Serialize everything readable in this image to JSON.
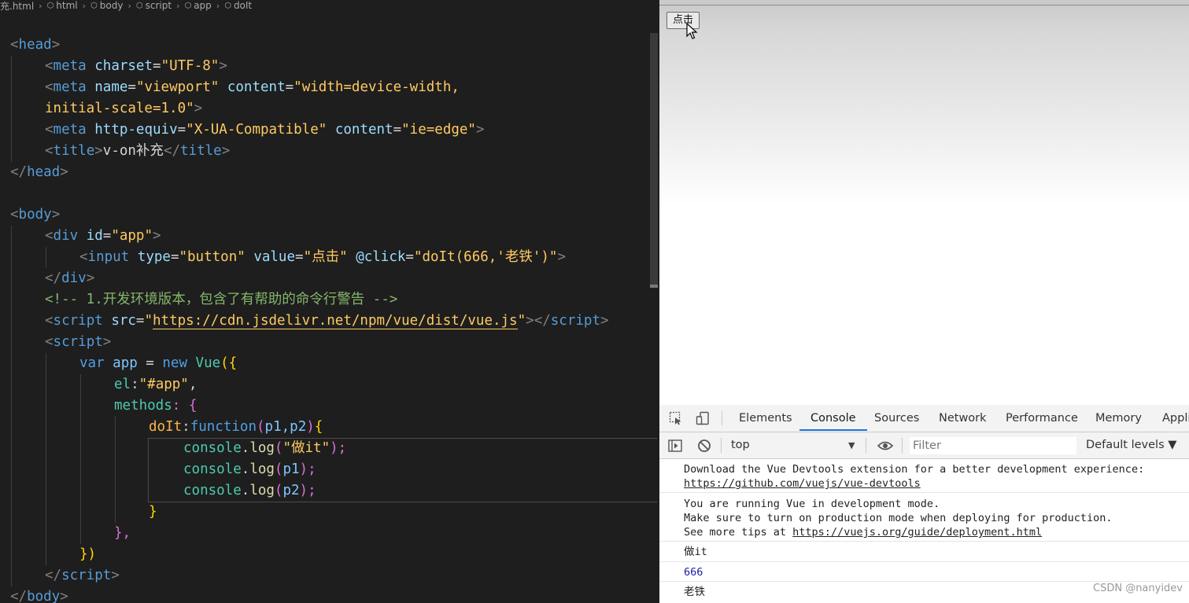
{
  "breadcrumb": [
    "充.html",
    "html",
    "body",
    "script",
    "app",
    "doIt"
  ],
  "code": {
    "head_open": "head",
    "meta1": {
      "tag": "meta",
      "attr": "charset",
      "val": "\"UTF-8\""
    },
    "meta2": {
      "tag": "meta",
      "attr1": "name",
      "val1": "\"viewport\"",
      "attr2": "content",
      "val2a": "\"width=device-width,",
      "val2b": "initial-scale=1.0\""
    },
    "meta3": {
      "tag": "meta",
      "attr1": "http-equiv",
      "val1": "\"X-UA-Compatible\"",
      "attr2": "content",
      "val2": "\"ie=edge\""
    },
    "title": {
      "tag": "title",
      "text": "v-on补充"
    },
    "head_close": "head",
    "body_open": "body",
    "div_open": {
      "tag": "div",
      "attr": "id",
      "val": "\"app\""
    },
    "input": {
      "tag": "input",
      "attr1": "type",
      "val1": "\"button\"",
      "attr2": "value",
      "val2": "\"点击\"",
      "attr3": "@click",
      "val3": "\"doIt(666,'老铁')\""
    },
    "div_close": "div",
    "comment": "<!-- 1.开发环境版本，包含了有帮助的命令行警告 -->",
    "script_src": {
      "tag": "script",
      "attr": "src",
      "q1": "\"",
      "url": "https://cdn.jsdelivr.net/npm/vue/dist/vue.js",
      "q2": "\"",
      "close": "script"
    },
    "script_open": "script",
    "var_line": {
      "kw": "var",
      "name": "app",
      "eq": " = ",
      "new": "new",
      "cls": "Vue",
      "open": "({"
    },
    "el_line": {
      "key": "el",
      "colon": ":",
      "val": "\"#app\"",
      "comma": ","
    },
    "methods_line": {
      "key": "methods",
      "rest": ": {"
    },
    "doit_line": {
      "name": "doIt",
      "colon": ":",
      "fn": "function",
      "p_open": "(",
      "params": "p1,p2",
      "p_close": ")",
      "brace": "{"
    },
    "log1": {
      "obj": "console",
      "dot": ".",
      "fn": "log",
      "open": "(",
      "arg": "\"做it\"",
      "close": ");"
    },
    "log2": {
      "obj": "console",
      "dot": ".",
      "fn": "log",
      "open": "(",
      "arg": "p1",
      "close": ");"
    },
    "log3": {
      "obj": "console",
      "dot": ".",
      "fn": "log",
      "open": "(",
      "arg": "p2",
      "close": ");"
    },
    "brace_close": "}",
    "methods_close": "},",
    "vue_close": "})",
    "script_close": "script",
    "body_close": "body"
  },
  "browser": {
    "button_label": "点击"
  },
  "devtools": {
    "tabs": [
      "Elements",
      "Console",
      "Sources",
      "Network",
      "Performance",
      "Memory",
      "Appli"
    ],
    "active_tab": "Console",
    "context": "top",
    "filter_placeholder": "Filter",
    "levels": "Default levels ▼",
    "messages": {
      "m1_l1": "Download the Vue Devtools extension for a better development experience:",
      "m1_link": "https://github.com/vuejs/vue-devtools",
      "m2_l1": "You are running Vue in development mode.",
      "m2_l2": "Make sure to turn on production mode when deploying for production.",
      "m2_l3_pre": "See more tips at ",
      "m2_link": "https://vuejs.org/guide/deployment.html",
      "m3": "做it",
      "m4": "666",
      "m5": "老铁"
    }
  },
  "watermark": "CSDN @nanyidev",
  "colors": {
    "editor_bg": "#1e1e1e",
    "accent": "#1a73e8",
    "string": "#ffca62",
    "tag": "#569cd6",
    "comment": "#85b66b"
  }
}
